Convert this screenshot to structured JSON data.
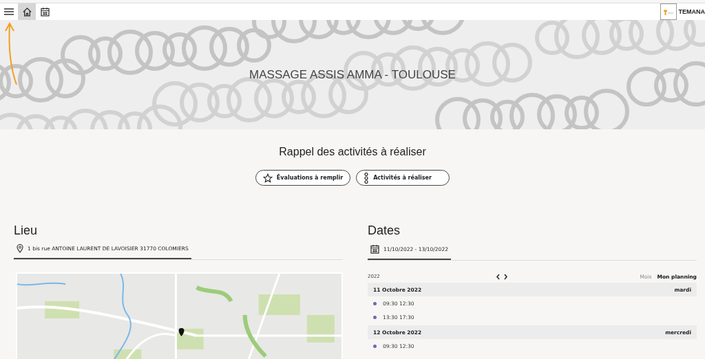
{
  "toolbar": {
    "items": [
      {
        "kind": "menu",
        "selected": false
      },
      {
        "kind": "home",
        "selected": true
      },
      {
        "kind": "calendar",
        "selected": false
      }
    ],
    "brand": "TEMANA"
  },
  "banner": {
    "title": "MASSAGE ASSIS AMMA - TOULOUSE"
  },
  "reminder": {
    "title": "Rappel des activités à réaliser",
    "buttons": [
      {
        "kind": "star",
        "label": "Évaluations à remplir"
      },
      {
        "kind": "steps",
        "label": "Activités à réaliser"
      }
    ]
  },
  "place": {
    "heading": "Lieu",
    "address": "1 bis rue ANTOINE LAURENT DE LAVOISIER 31770 COLOMIERS"
  },
  "dates": {
    "heading": "Dates",
    "range": "11/10/2022 - 13/10/2022",
    "year": "2022",
    "views": [
      {
        "label": "Mois",
        "selected": false
      },
      {
        "label": "Mon planning",
        "selected": true
      }
    ],
    "days": [
      {
        "date": "11 Octobre 2022",
        "weekday": "mardi",
        "slots": [
          {
            "time": "09:30 12:30",
            "color": "#6b6bb0"
          },
          {
            "time": "13:30 17:30",
            "color": "#6b6bb0"
          }
        ]
      },
      {
        "date": "12 Octobre 2022",
        "weekday": "mercredi",
        "slots": [
          {
            "time": "09:30 12:30",
            "color": "#6b6bb0"
          }
        ]
      }
    ]
  }
}
